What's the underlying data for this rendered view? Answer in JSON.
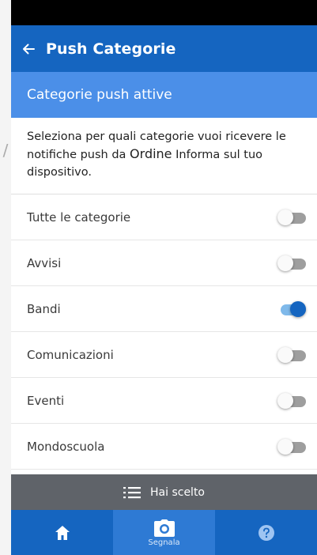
{
  "header": {
    "title": "Push Categorie"
  },
  "section": {
    "title": "Categorie push attive"
  },
  "intro": {
    "part1": "Seleziona per quali categorie vuoi ricevere le notifiche push da ",
    "brand": "Ordine",
    "part2": " Informa sul tuo dispositivo."
  },
  "categories": [
    {
      "label": "Tutte le categorie",
      "enabled": false
    },
    {
      "label": "Avvisi",
      "enabled": false
    },
    {
      "label": "Bandi",
      "enabled": true
    },
    {
      "label": "Comunicazioni",
      "enabled": false
    },
    {
      "label": "Eventi",
      "enabled": false
    },
    {
      "label": "Mondoscuola",
      "enabled": false
    }
  ],
  "chosen_bar": {
    "label": "Hai scelto",
    "icon": "list-icon"
  },
  "bottom_nav": [
    {
      "label": "",
      "icon": "home-icon"
    },
    {
      "label": "Segnala",
      "icon": "camera-icon"
    },
    {
      "label": "",
      "icon": "help-icon"
    }
  ],
  "colors": {
    "primary": "#1565c0",
    "section": "#4b8fe8",
    "toggle_on_track": "#7fb9ea",
    "chosen_bar": "#5f6369"
  }
}
